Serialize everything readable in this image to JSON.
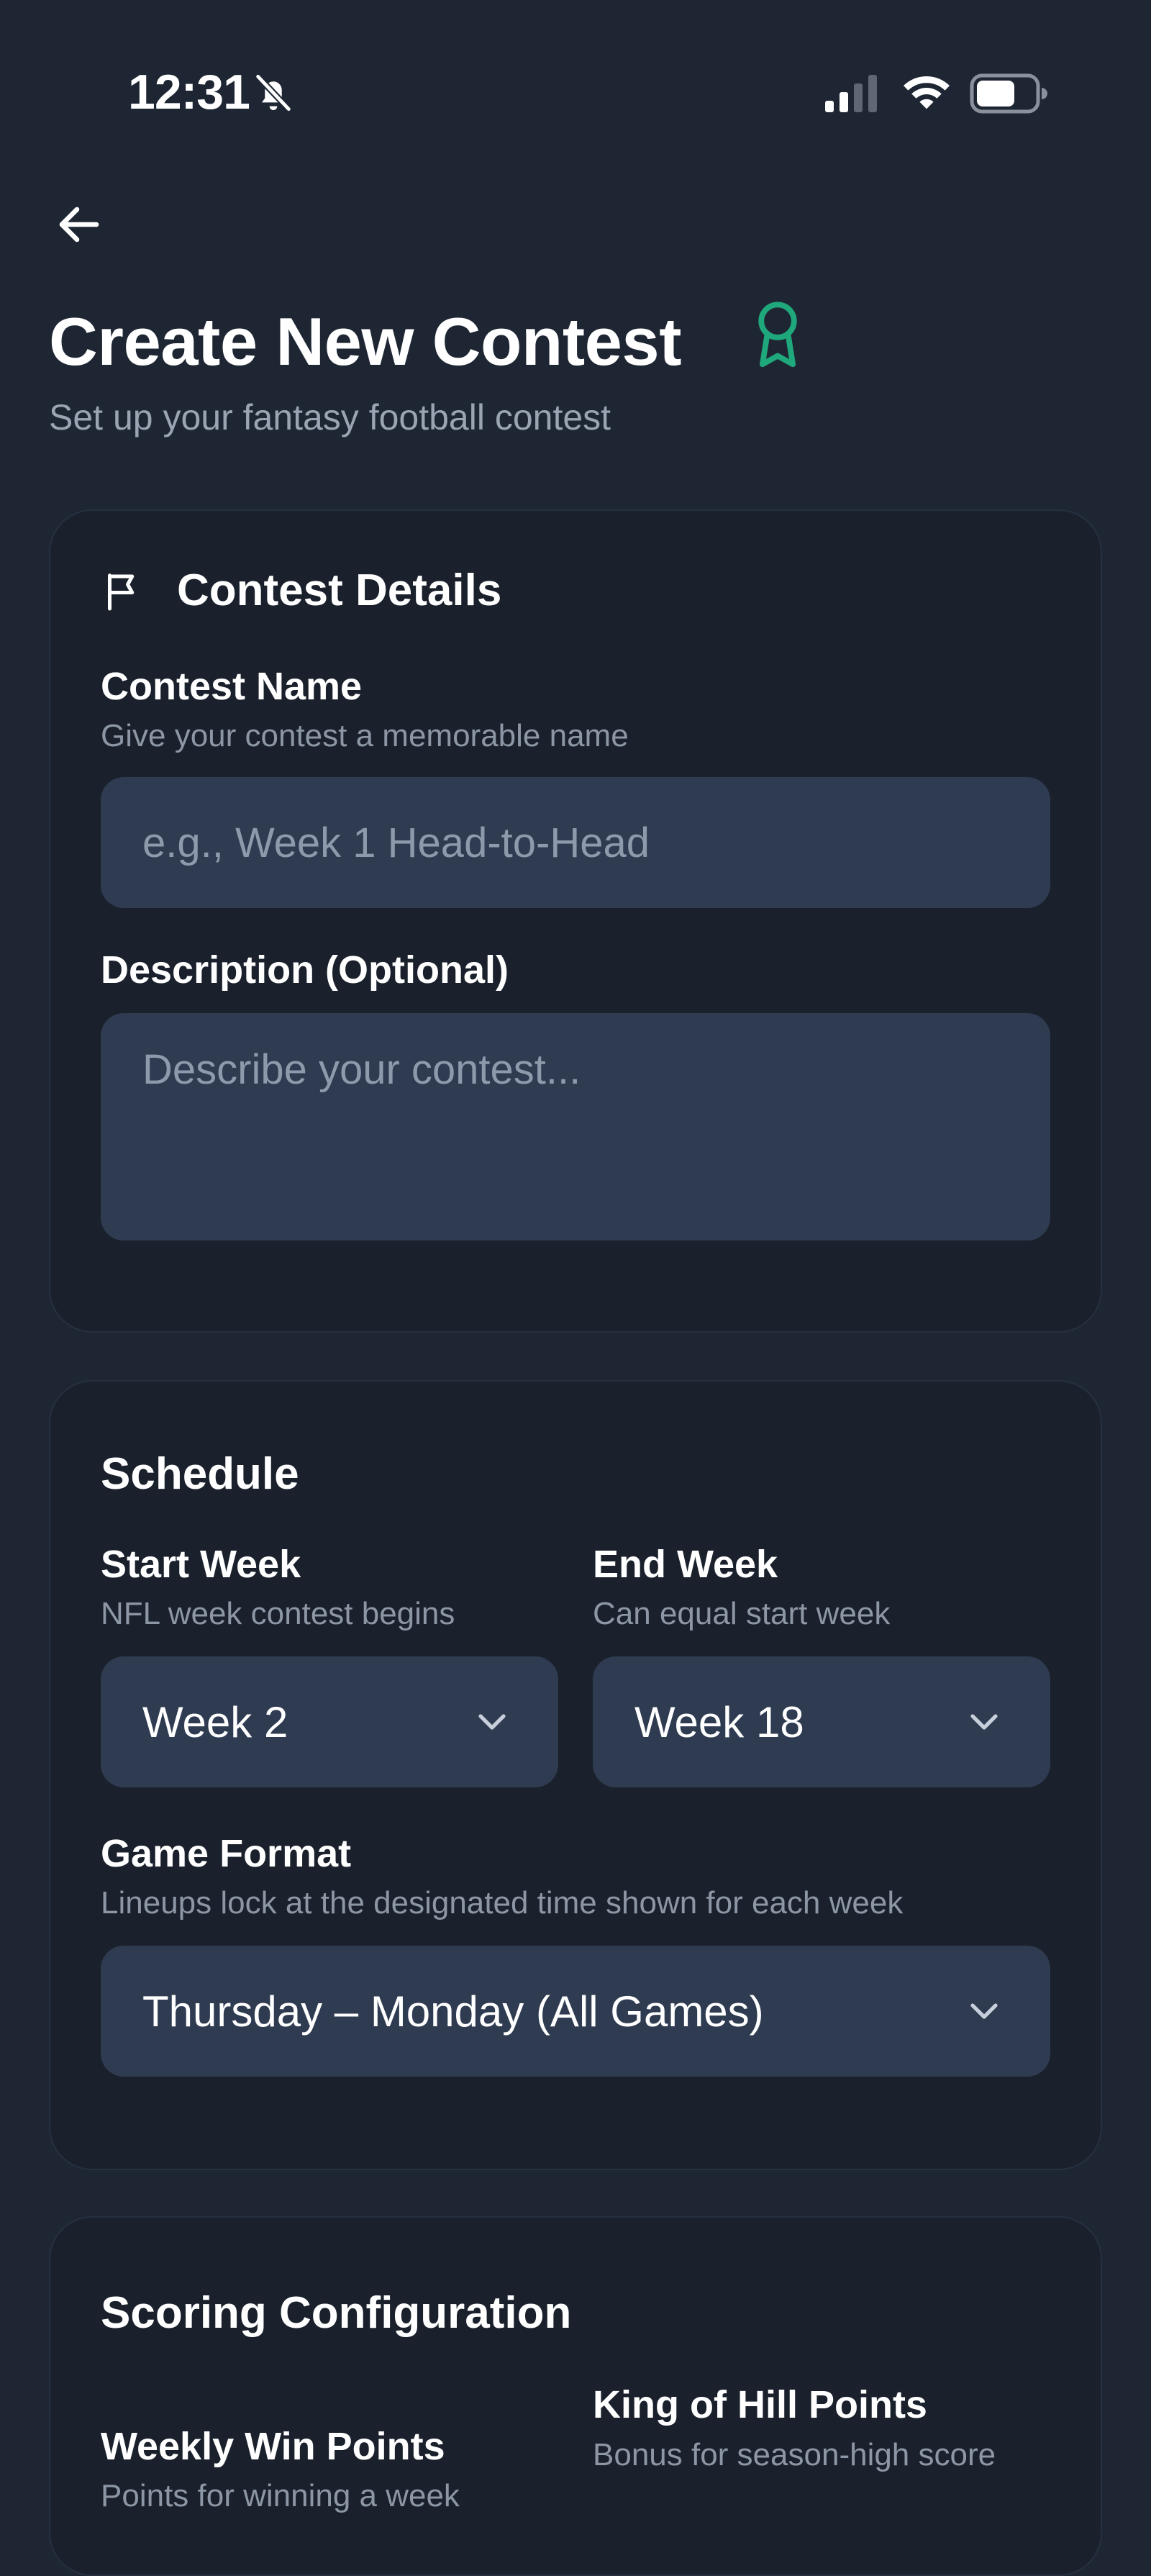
{
  "status_bar": {
    "time": "12:31"
  },
  "colors": {
    "background": "#1e2633",
    "card": "#1a212c",
    "input": "#2e3b51",
    "accent": "#1fa87b",
    "muted_text": "#8c96a4"
  },
  "header": {
    "back_icon": "arrow-left-icon",
    "title": "Create New Contest",
    "title_icon": "award-icon",
    "subtitle": "Set up your fantasy football contest"
  },
  "details": {
    "icon": "flag-icon",
    "heading": "Contest Details",
    "name_label": "Contest Name",
    "name_help": "Give your contest a memorable name",
    "name_placeholder": "e.g., Week 1 Head-to-Head",
    "name_value": "",
    "description_label": "Description (Optional)",
    "description_placeholder": "Describe your contest...",
    "description_value": ""
  },
  "schedule": {
    "heading": "Schedule",
    "start_label": "Start Week",
    "start_help": "NFL week contest begins",
    "start_value": "Week 2",
    "end_label": "End Week",
    "end_help": "Can equal start week",
    "end_value": "Week 18",
    "format_label": "Game Format",
    "format_help": "Lineups lock at the designated time shown for each week",
    "format_value": "Thursday – Monday (All Games)"
  },
  "scoring": {
    "heading": "Scoring Configuration",
    "weekly_label": "Weekly Win Points",
    "weekly_help": "Points for winning a week",
    "koh_label": "King of Hill Points",
    "koh_help": "Bonus for season-high score"
  }
}
